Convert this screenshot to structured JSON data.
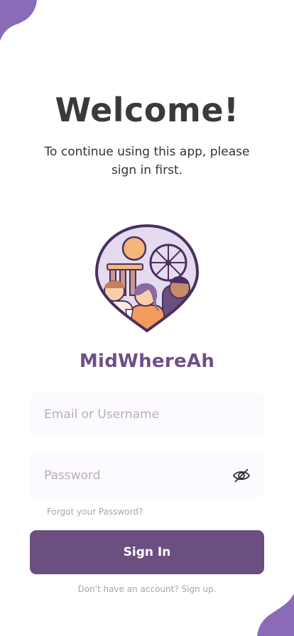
{
  "header": {
    "title": "Welcome!",
    "subtitle": "To continue using this app, please sign in first."
  },
  "brand": {
    "name": "MidWhereAh",
    "logo_icon": "location-pin-with-friends-icon",
    "color": "#6f4f86"
  },
  "form": {
    "email_placeholder": "Email or Username",
    "email_value": "",
    "password_placeholder": "Password",
    "password_value": "",
    "password_toggle_icon": "eye-off-icon",
    "forgot_label": "Forgot your Password?",
    "signin_label": "Sign In",
    "signup_prompt": "Don't have an account? Sign up."
  },
  "colors": {
    "accent": "#6b4f80",
    "blob": "#8a6bb8",
    "field_bg": "#fcf9ff"
  }
}
